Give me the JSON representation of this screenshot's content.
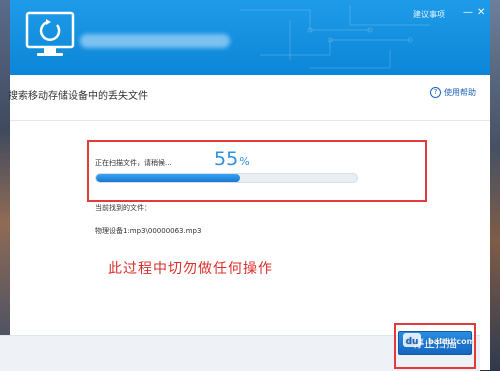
{
  "titlebar": {
    "suggest_label": "建议事项",
    "minimize_label": "—",
    "close_label": "✕"
  },
  "section": {
    "title": "搜索移动存储设备中的丢失文件",
    "help_icon_glyph": "?",
    "help_label": "使用帮助"
  },
  "scan": {
    "status_text": "正在扫描文件，请稍候...",
    "percent_value": "55",
    "percent_sign": "%",
    "progress": 0.55,
    "found_label": "当前找到的文件：",
    "found_file": "物理设备1:mp3\\00000063.mp3"
  },
  "warning_text": "此过程中切勿做任何操作",
  "footer": {
    "stop_label": "停止扫描"
  },
  "colors": {
    "accent": "#0c86d8",
    "progress": "#1677d3",
    "warning": "#d9302c",
    "highlight_box": "#e23b3b"
  }
}
